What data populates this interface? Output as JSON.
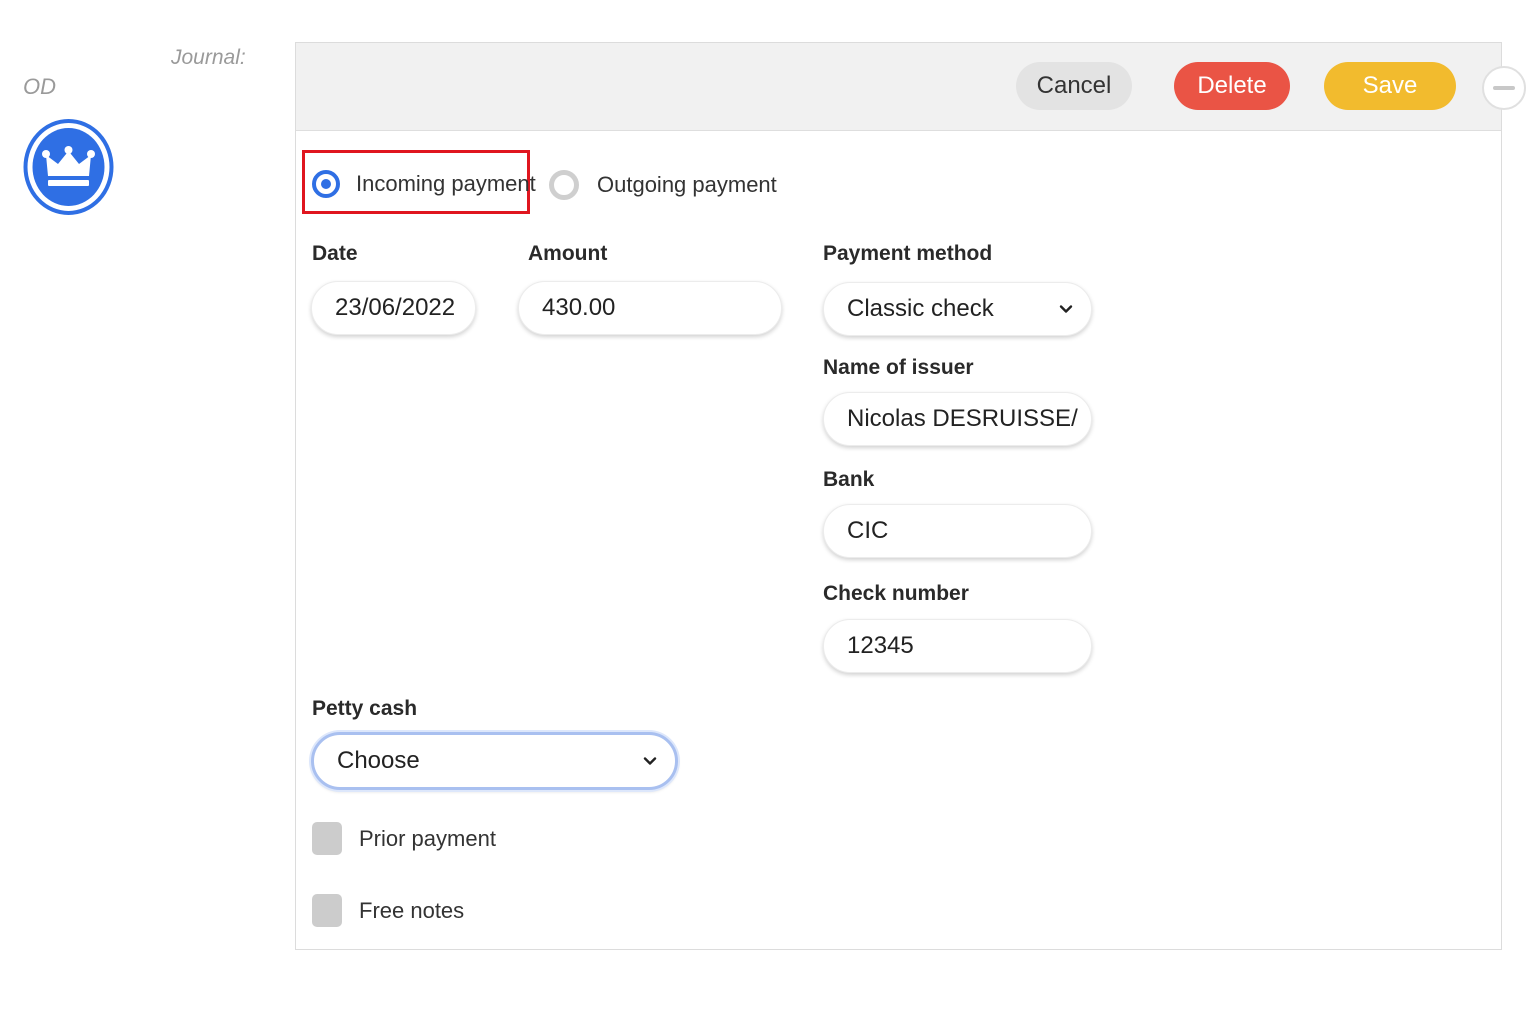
{
  "header": {
    "journal_label": "Journal:",
    "journal_code": "OD",
    "avatar_icon": "crown-icon",
    "accent_color": "#2f6fe4"
  },
  "toolbar": {
    "cancel_label": "Cancel",
    "delete_label": "Delete",
    "save_label": "Save",
    "collapse_icon": "minus-icon",
    "colors": {
      "cancel": "#e3e3e3",
      "delete": "#ea5445",
      "save": "#f2bb2e"
    }
  },
  "payment_type": {
    "options": [
      {
        "label": "Incoming payment",
        "selected": true
      },
      {
        "label": "Outgoing payment",
        "selected": false
      }
    ]
  },
  "form": {
    "date": {
      "label": "Date",
      "value": "23/06/2022"
    },
    "amount": {
      "label": "Amount",
      "value": "430.00"
    },
    "payment_method": {
      "label": "Payment method",
      "value": "Classic check",
      "icon": "chevron-down-icon"
    },
    "issuer": {
      "label": "Name of issuer",
      "value": "Nicolas DESRUISSE/"
    },
    "bank": {
      "label": "Bank",
      "value": "CIC"
    },
    "check_number": {
      "label": "Check number",
      "value": "12345"
    },
    "petty_cash": {
      "label": "Petty cash",
      "value": "Choose",
      "icon": "chevron-down-icon"
    },
    "prior_payment": {
      "label": "Prior payment",
      "checked": false
    },
    "free_notes": {
      "label": "Free notes",
      "checked": false
    }
  }
}
